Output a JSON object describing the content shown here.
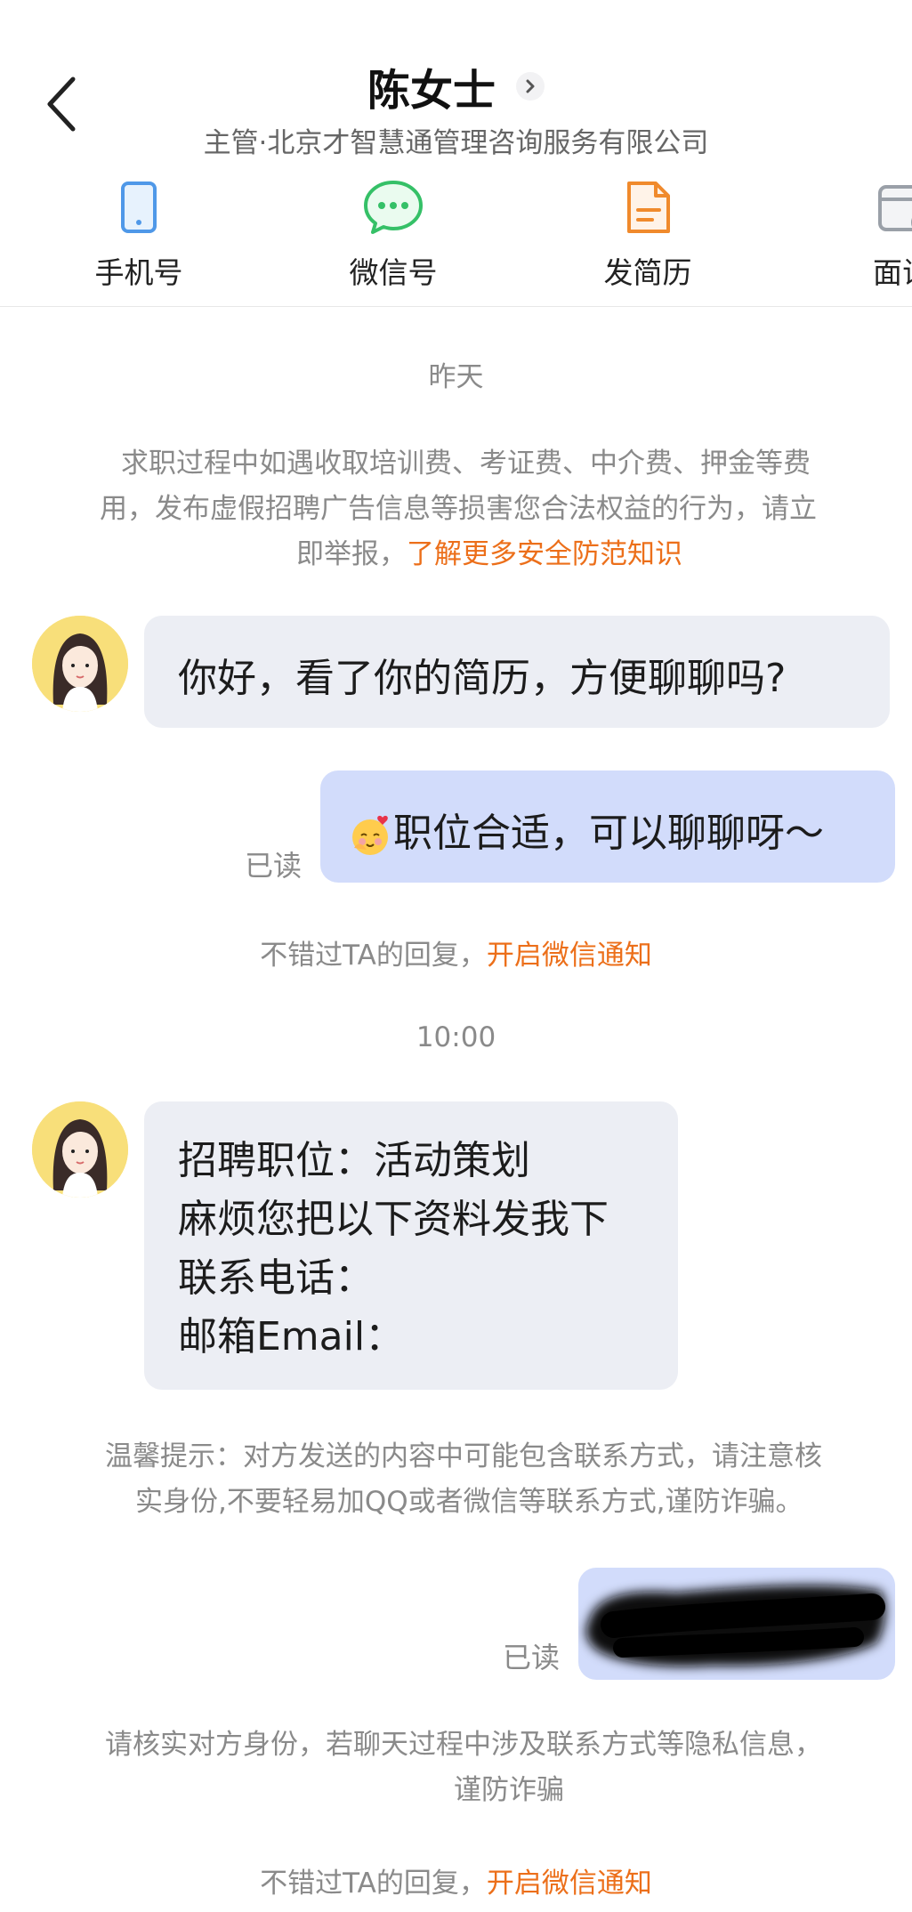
{
  "header": {
    "title": "陈女士",
    "subtitle": "主管·北京才智慧通管理咨询服务有限公司",
    "tools": [
      {
        "label": "手机号",
        "icon": "phone-icon"
      },
      {
        "label": "微信号",
        "icon": "wechat-icon"
      },
      {
        "label": "发简历",
        "icon": "resume-icon"
      },
      {
        "label": "面试",
        "icon": "calendar-icon"
      }
    ]
  },
  "chat": {
    "date_label": "昨天",
    "safety_notice": {
      "line1": "求职过程中如遇收取培训费、考证费、中介费、押金等费",
      "line2": "用，发布虚假招聘广告信息等损害您合法权益的行为，请立",
      "line3_prefix": "即举报，",
      "line3_link": "了解更多安全防范知识"
    },
    "msg1": "你好，看了你的简历，方便聊聊吗?",
    "msg2": "职位合适，可以聊聊呀～",
    "read_label": "已读",
    "wechat_tip": {
      "prefix": "不错过TA的回复，",
      "link": "开启微信通知"
    },
    "time_label": "10:00",
    "msg3_lines": [
      "招聘职位：活动策划",
      "麻烦您把以下资料发我下",
      "联系电话：",
      "邮箱Email："
    ],
    "warm_tip": {
      "line1": "温馨提示：对方发送的内容中可能包含联系方式，请注意核",
      "line2": "实身份,不要轻易加QQ或者微信等联系方式,谨防诈骗。"
    },
    "verify_tip": {
      "line1": "请核实对方身份，若聊天过程中涉及联系方式等隐私信息，",
      "line2": "谨防诈骗"
    }
  },
  "colors": {
    "accent_link": "#ec6f1a",
    "bubble_in": "#eceef4",
    "bubble_out": "#d2dcfb"
  }
}
